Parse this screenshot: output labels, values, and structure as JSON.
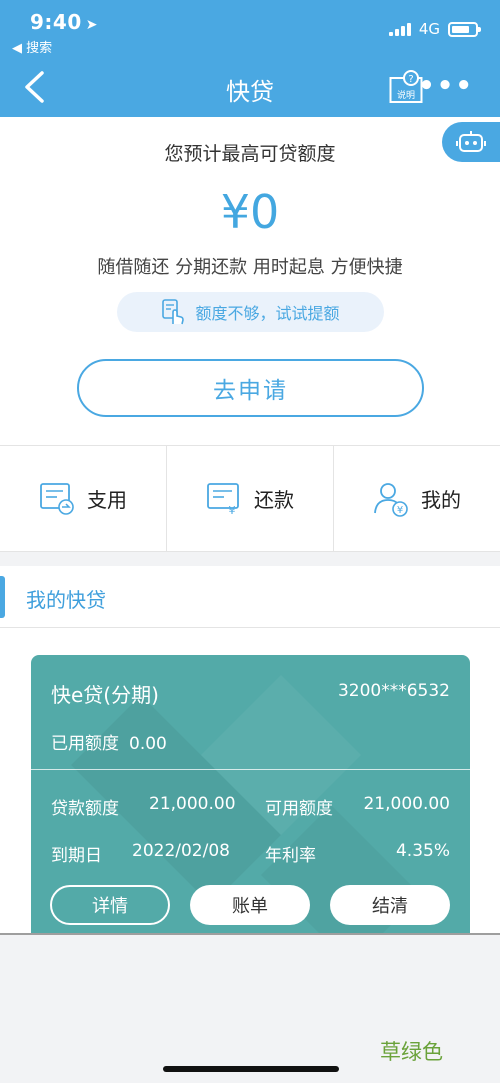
{
  "status": {
    "time": "9:40",
    "back_search": "◀ 搜索",
    "network": "4G",
    "battery_level": 0.75
  },
  "nav": {
    "title": "快贷",
    "help_label": "说明",
    "more": "•••"
  },
  "hero": {
    "subtitle": "您预计最高可贷额度",
    "amount": "¥0",
    "tagline": "随借随还 分期还款  用时起息 方便快捷",
    "hint": "额度不够，试试提额",
    "apply": "去申请"
  },
  "quick": [
    {
      "label": "支用",
      "icon": "withdraw-doc-icon"
    },
    {
      "label": "还款",
      "icon": "repay-doc-icon"
    },
    {
      "label": "我的",
      "icon": "user-yuan-icon"
    }
  ],
  "section": {
    "title": "我的快贷"
  },
  "card": {
    "name": "快e贷(分期)",
    "account": "3200***6532",
    "used_label": "已用额度",
    "used_value": "0.00",
    "loan_label": "贷款额度",
    "loan_value": "21,000.00",
    "avail_label": "可用额度",
    "avail_value": "21,000.00",
    "due_label": "到期日",
    "due_value": "2022/02/08",
    "rate_label": "年利率",
    "rate_value": "4.35%",
    "buttons": [
      "详情",
      "账单",
      "结清"
    ]
  },
  "watermark": "草绿色",
  "colors": {
    "primary": "#4aa8e2",
    "card": "#53aaa8",
    "watermark": "#6aa23a"
  }
}
